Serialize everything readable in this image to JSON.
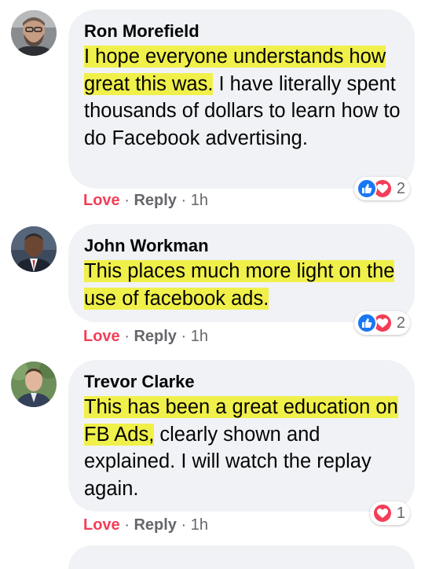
{
  "comments": [
    {
      "author": "Ron Morefield",
      "highlighted_text": "I hope everyone understands how great this was.",
      "text": " I have literally spent thousands of dollars to learn how to do Facebook advertising.",
      "actions": {
        "love": "Love",
        "reply": "Reply",
        "time": "1h"
      },
      "reactions": {
        "icons": [
          "like-icon",
          "love-icon"
        ],
        "count": "2"
      }
    },
    {
      "author": "John Workman",
      "highlighted_text": "This places much more light on the use of facebook ads.",
      "text": "",
      "actions": {
        "love": "Love",
        "reply": "Reply",
        "time": "1h"
      },
      "reactions": {
        "icons": [
          "like-icon",
          "love-icon"
        ],
        "count": "2"
      }
    },
    {
      "author": "Trevor Clarke",
      "highlighted_text": "This has been a great education on FB Ads,",
      "text": " clearly shown and explained. I will watch the replay again.",
      "actions": {
        "love": "Love",
        "reply": "Reply",
        "time": "1h"
      },
      "reactions": {
        "icons": [
          "love-icon"
        ],
        "count": "1"
      }
    }
  ],
  "separator": "·",
  "colors": {
    "bubble": "#f0f2f5",
    "highlight": "#f0f04a",
    "love_action": "#f33e58",
    "like_blue": "#1877f2",
    "muted_text": "#65676b"
  }
}
